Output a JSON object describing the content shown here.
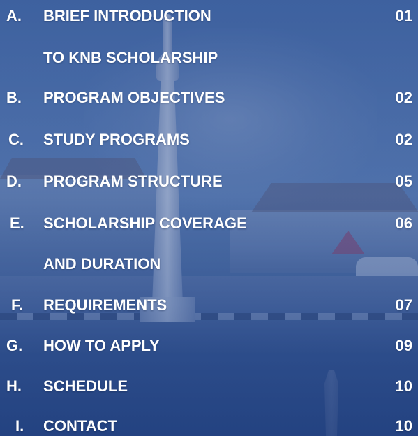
{
  "toc": {
    "items": [
      {
        "letter": "A.",
        "title_lines": [
          "BRIEF INTRODUCTION",
          "TO KNB SCHOLARSHIP"
        ],
        "page": "01"
      },
      {
        "letter": "B.",
        "title_lines": [
          "PROGRAM OBJECTIVES"
        ],
        "page": "02"
      },
      {
        "letter": "C.",
        "title_lines": [
          "STUDY PROGRAMS"
        ],
        "page": "02"
      },
      {
        "letter": "D.",
        "title_lines": [
          "PROGRAM STRUCTURE"
        ],
        "page": "05"
      },
      {
        "letter": "E.",
        "title_lines": [
          "SCHOLARSHIP COVERAGE",
          "AND DURATION"
        ],
        "page": "06"
      },
      {
        "letter": "F.",
        "title_lines": [
          "REQUIREMENTS"
        ],
        "page": "07"
      },
      {
        "letter": "G.",
        "title_lines": [
          "HOW TO APPLY"
        ],
        "page": "09"
      },
      {
        "letter": "H.",
        "title_lines": [
          "SCHEDULE"
        ],
        "page": "10"
      },
      {
        "letter": "I.",
        "title_lines": [
          "CONTACT"
        ],
        "page": "10"
      }
    ]
  },
  "colors": {
    "text": "#ffffff",
    "overlay": "#26488c"
  }
}
